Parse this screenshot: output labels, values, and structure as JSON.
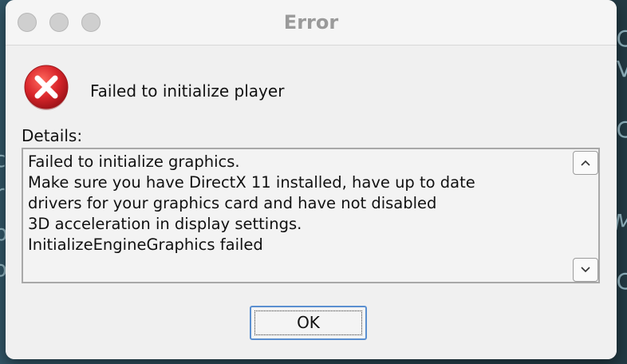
{
  "window": {
    "title": "Error"
  },
  "dialog": {
    "icon": "error-icon",
    "message": "Failed to initialize player",
    "details_label": "Details:",
    "details_text": "Failed to initialize graphics.\nMake sure you have DirectX 11 installed, have up to date\ndrivers for your graphics card and have not disabled\n3D acceleration in display settings.\nInitializeEngineGraphics failed",
    "ok_label": "OK"
  },
  "background": {
    "glyphs": [
      "C",
      "V",
      "C",
      "M",
      "C",
      "c",
      "r",
      "p",
      "o"
    ]
  },
  "colors": {
    "error_red": "#d9262b",
    "button_border": "#5a8fd0",
    "title_text": "#9a9a9a"
  }
}
